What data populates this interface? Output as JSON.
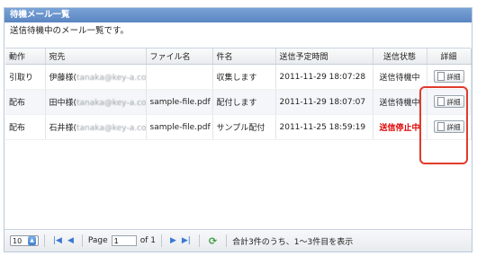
{
  "panel": {
    "title": "待機メール一覧",
    "subtitle": "送信待機中のメール一覧です。"
  },
  "table": {
    "headers": {
      "action": "動作",
      "recipient": "宛先",
      "filename": "ファイル名",
      "subject": "件名",
      "scheduled": "送信予定時間",
      "status": "送信状態",
      "detail": "詳細"
    },
    "rows": [
      {
        "action": "引取り",
        "recipient": "伊藤様(",
        "email": "tanaka@key-a.co.jp",
        "recipient_close": ")",
        "filename": "",
        "subject": "収集します",
        "scheduled": "2011-11-29 18:07:28",
        "status": "送信待機中",
        "detail": "詳細"
      },
      {
        "action": "配布",
        "recipient": "田中様(",
        "email": "tanaka@key-a.co.jp",
        "recipient_close": ")",
        "filename": "sample-file.pdf",
        "subject": "配付します",
        "scheduled": "2011-11-29 18:07:07",
        "status": "送信待機中",
        "detail": "詳細"
      },
      {
        "action": "配布",
        "recipient": "石井様(",
        "email": "tanaka@key-a.co.jp",
        "recipient_close": ")",
        "filename": "sample-file.pdf",
        "subject": "サンプル配付",
        "scheduled": "2011-11-25 18:59:19",
        "status": "送信停止中",
        "detail": "詳細"
      }
    ]
  },
  "pager": {
    "page_size": "10",
    "page_label": "Page",
    "current_page": "1",
    "of_label": "of 1",
    "summary": "合計3件のうち、1～3件目を表示"
  },
  "colors": {
    "title_bg": "#5a86c2",
    "status_stopped": "#e00000",
    "highlight": "#e03b2c"
  }
}
